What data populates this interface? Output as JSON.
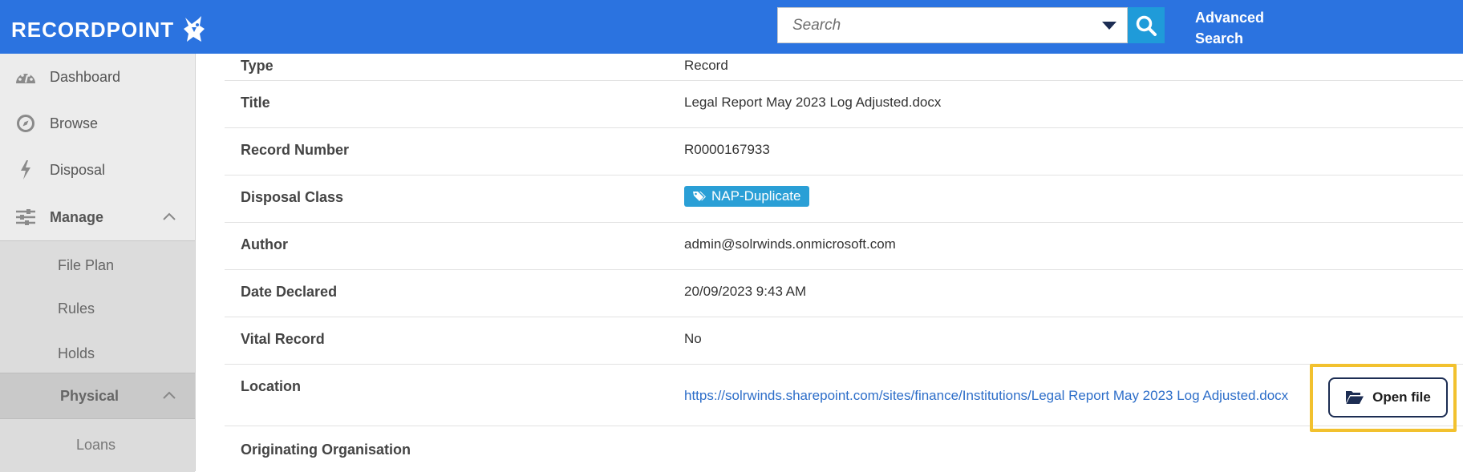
{
  "header": {
    "logo_text": "RECORDPOINT",
    "search_placeholder": "Search",
    "advanced_search": "Advanced Search",
    "colors": {
      "bar": "#2b73e0",
      "search_button": "#1f9bd9"
    }
  },
  "sidebar": {
    "items": [
      {
        "label": "Dashboard",
        "icon": "dashboard-icon"
      },
      {
        "label": "Browse",
        "icon": "compass-icon"
      },
      {
        "label": "Disposal",
        "icon": "bolt-icon"
      },
      {
        "label": "Manage",
        "icon": "sliders-icon",
        "expanded": true
      }
    ],
    "manage_items": [
      {
        "label": "File Plan"
      },
      {
        "label": "Rules"
      },
      {
        "label": "Holds"
      }
    ],
    "physical": {
      "label": "Physical",
      "expanded": true
    },
    "physical_items": [
      {
        "label": "Loans"
      }
    ]
  },
  "properties": {
    "type": {
      "label": "Type",
      "value": "Record"
    },
    "title": {
      "label": "Title",
      "value": "Legal Report May 2023 Log Adjusted.docx"
    },
    "record_number": {
      "label": "Record Number",
      "value": "R0000167933"
    },
    "disposal_class": {
      "label": "Disposal Class",
      "value": "NAP-Duplicate",
      "tag_color": "#2a9fd6"
    },
    "author": {
      "label": "Author",
      "value": "admin@solrwinds.onmicrosoft.com"
    },
    "date_declared": {
      "label": "Date Declared",
      "value": "20/09/2023 9:43 AM"
    },
    "vital_record": {
      "label": "Vital Record",
      "value": "No"
    },
    "location": {
      "label": "Location",
      "value": "https://solrwinds.sharepoint.com/sites/finance/Institutions/Legal Report May 2023 Log Adjusted.docx",
      "button": "Open file"
    },
    "originating_org": {
      "label": "Originating Organisation",
      "value": ""
    }
  }
}
